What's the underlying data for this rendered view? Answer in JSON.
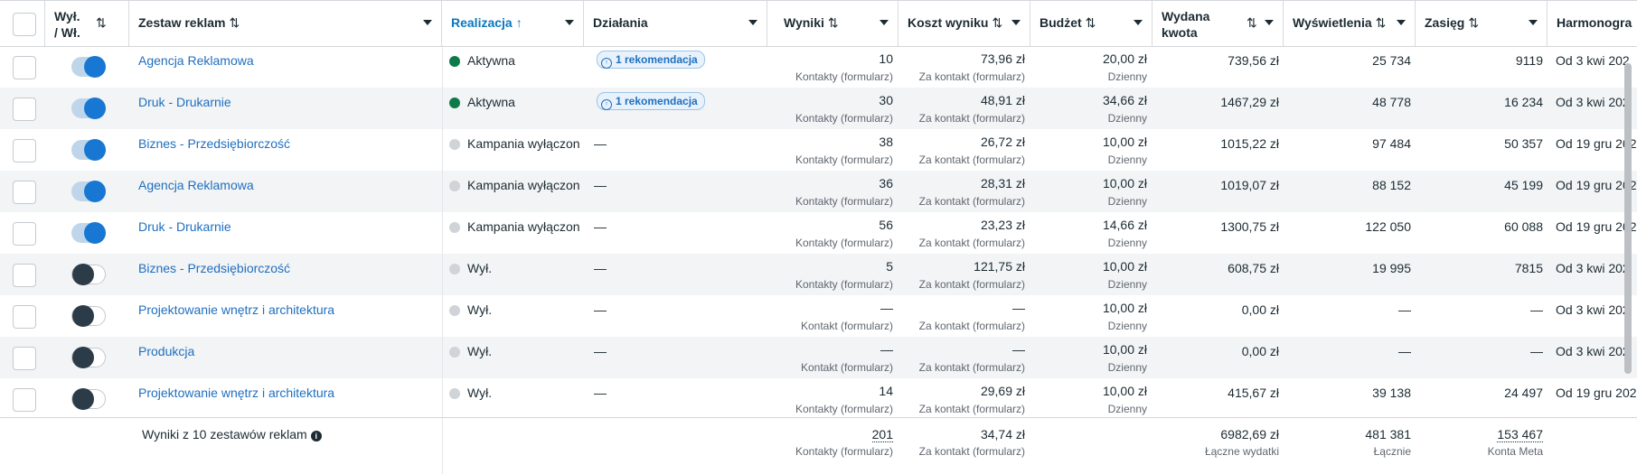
{
  "columns": {
    "toggle": "Wył. / Wł.",
    "toggle_l1": "Wył.",
    "toggle_l2": "/ Wł.",
    "name": "Zestaw reklam",
    "delivery": "Realizacja",
    "actions": "Działania",
    "results": "Wyniki",
    "cost": "Koszt wyniku",
    "budget": "Budżet",
    "spent_l1": "Wydana",
    "spent_l2": "kwota",
    "impressions": "Wyświetlenia",
    "reach": "Zasięg",
    "schedule": "Harmonogra"
  },
  "sort_icon": "⇅",
  "sort_up_icon": "↑",
  "rows": [
    {
      "on": true,
      "name": "Agencja Reklamowa",
      "status": "Aktywna",
      "status_color": "#0e7a4a",
      "rec": "1 rekomendacja",
      "results": "10",
      "results_sub": "Kontakty (formularz)",
      "cost": "73,96 zł",
      "cost_sub": "Za kontakt (formularz)",
      "budget": "20,00 zł",
      "budget_sub": "Dzienny",
      "spent": "739,56 zł",
      "impressions": "25 734",
      "reach": "9119",
      "schedule": "Od 3 kwi 202"
    },
    {
      "on": true,
      "name": "Druk - Drukarnie",
      "status": "Aktywna",
      "status_color": "#0e7a4a",
      "rec": "1 rekomendacja",
      "results": "30",
      "results_sub": "Kontakty (formularz)",
      "cost": "48,91 zł",
      "cost_sub": "Za kontakt (formularz)",
      "budget": "34,66 zł",
      "budget_sub": "Dzienny",
      "spent": "1467,29 zł",
      "impressions": "48 778",
      "reach": "16 234",
      "schedule": "Od 3 kwi 202"
    },
    {
      "on": true,
      "name": "Biznes - Przedsiębiorczość",
      "status": "Kampania wyłączona",
      "status_color": "#d0d3d7",
      "rec": "",
      "results": "38",
      "results_sub": "Kontakty (formularz)",
      "cost": "26,72 zł",
      "cost_sub": "Za kontakt (formularz)",
      "budget": "10,00 zł",
      "budget_sub": "Dzienny",
      "spent": "1015,22 zł",
      "impressions": "97 484",
      "reach": "50 357",
      "schedule": "Od 19 gru 202"
    },
    {
      "on": true,
      "name": "Agencja Reklamowa",
      "status": "Kampania wyłączona",
      "status_color": "#d0d3d7",
      "rec": "",
      "results": "36",
      "results_sub": "Kontakty (formularz)",
      "cost": "28,31 zł",
      "cost_sub": "Za kontakt (formularz)",
      "budget": "10,00 zł",
      "budget_sub": "Dzienny",
      "spent": "1019,07 zł",
      "impressions": "88 152",
      "reach": "45 199",
      "schedule": "Od 19 gru 202"
    },
    {
      "on": true,
      "name": "Druk - Drukarnie",
      "status": "Kampania wyłączona",
      "status_color": "#d0d3d7",
      "rec": "",
      "results": "56",
      "results_sub": "Kontakty (formularz)",
      "cost": "23,23 zł",
      "cost_sub": "Za kontakt (formularz)",
      "budget": "14,66 zł",
      "budget_sub": "Dzienny",
      "spent": "1300,75 zł",
      "impressions": "122 050",
      "reach": "60 088",
      "schedule": "Od 19 gru 202"
    },
    {
      "on": false,
      "name": "Biznes - Przedsiębiorczość",
      "status": "Wył.",
      "status_color": "#d0d3d7",
      "rec": "",
      "results": "5",
      "results_sub": "Kontakty (formularz)",
      "cost": "121,75 zł",
      "cost_sub": "Za kontakt (formularz)",
      "budget": "10,00 zł",
      "budget_sub": "Dzienny",
      "spent": "608,75 zł",
      "impressions": "19 995",
      "reach": "7815",
      "schedule": "Od 3 kwi 202"
    },
    {
      "on": false,
      "name": "Projektowanie wnętrz i architektura",
      "status": "Wył.",
      "status_color": "#d0d3d7",
      "rec": "",
      "results": "—",
      "results_sub": "Kontakt (formularz)",
      "cost": "—",
      "cost_sub": "Za kontakt (formularz)",
      "budget": "10,00 zł",
      "budget_sub": "Dzienny",
      "spent": "0,00 zł",
      "impressions": "—",
      "reach": "—",
      "schedule": "Od 3 kwi 202"
    },
    {
      "on": false,
      "name": "Produkcja",
      "status": "Wył.",
      "status_color": "#d0d3d7",
      "rec": "",
      "results": "—",
      "results_sub": "Kontakt (formularz)",
      "cost": "—",
      "cost_sub": "Za kontakt (formularz)",
      "budget": "10,00 zł",
      "budget_sub": "Dzienny",
      "spent": "0,00 zł",
      "impressions": "—",
      "reach": "—",
      "schedule": "Od 3 kwi 202"
    },
    {
      "on": false,
      "name": "Projektowanie wnętrz i architektura",
      "status": "Wył.",
      "status_color": "#d0d3d7",
      "rec": "",
      "results": "14",
      "results_sub": "Kontakty (formularz)",
      "cost": "29,69 zł",
      "cost_sub": "Za kontakt (formularz)",
      "budget": "10,00 zł",
      "budget_sub": "Dzienny",
      "spent": "415,67 zł",
      "impressions": "39 138",
      "reach": "24 497",
      "schedule": "Od 19 gru 202"
    }
  ],
  "dash": "—",
  "footer": {
    "label": "Wyniki z 10 zestawów reklam",
    "info_icon": "info-icon",
    "results": "201",
    "results_sub": "Kontakty (formularz)",
    "cost": "34,74 zł",
    "cost_sub": "Za kontakt (formularz)",
    "spent": "6982,69 zł",
    "spent_sub": "Łączne wydatki",
    "impressions": "481 381",
    "impressions_sub": "Łącznie",
    "reach": "153 467",
    "reach_sub": "Konta Meta"
  },
  "colors": {
    "link": "#1f6fbf",
    "active_dot": "#0e7a4a",
    "inactive_dot": "#d0d3d7",
    "toggle_on": "#1877d2"
  }
}
